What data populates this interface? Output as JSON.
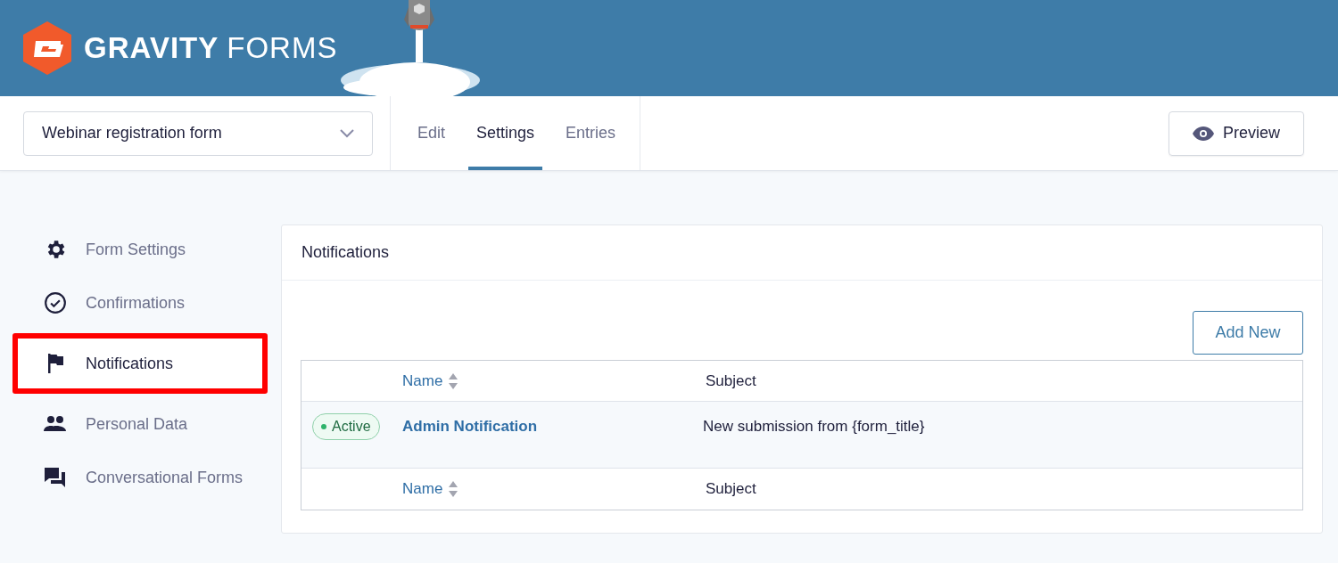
{
  "header": {
    "logo_text_bold": "GRAVITY",
    "logo_text_light": "FORMS"
  },
  "toolbar": {
    "form_select": {
      "value": "Webinar registration form"
    },
    "tabs": [
      {
        "label": "Edit",
        "selected": false
      },
      {
        "label": "Settings",
        "selected": true
      },
      {
        "label": "Entries",
        "selected": false
      }
    ],
    "preview_button": "Preview"
  },
  "sidebar": {
    "items": [
      {
        "label": "Form Settings",
        "selected": false,
        "highlighted": false
      },
      {
        "label": "Confirmations",
        "selected": false,
        "highlighted": false
      },
      {
        "label": "Notifications",
        "selected": true,
        "highlighted": true
      },
      {
        "label": "Personal Data",
        "selected": false,
        "highlighted": false
      },
      {
        "label": "Conversational Forms",
        "selected": false,
        "highlighted": false
      }
    ]
  },
  "panel": {
    "title": "Notifications",
    "add_button": "Add New",
    "table": {
      "columns": [
        "Name",
        "Subject"
      ],
      "rows": [
        {
          "status": "Active",
          "active": true,
          "name": "Admin Notification",
          "subject": "New submission from {form_title}"
        }
      ],
      "footer_columns": [
        "Name",
        "Subject"
      ]
    }
  }
}
